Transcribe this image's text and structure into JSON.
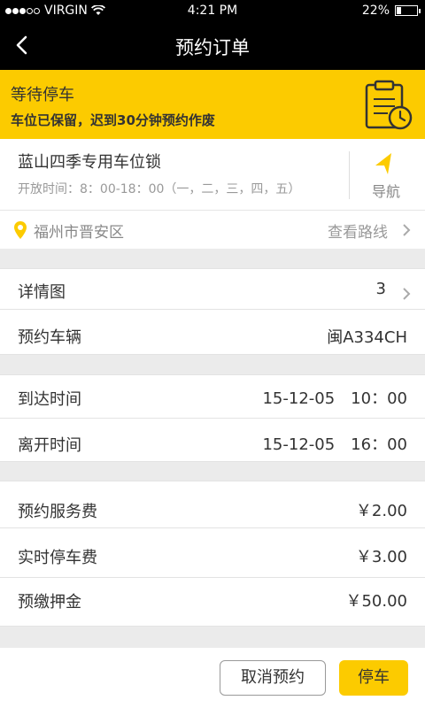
{
  "status_bar": {
    "carrier": "VIRGIN",
    "time": "4:21 PM",
    "battery": "22%",
    "signal_bars_filled": 3,
    "signal_bars_total": 5,
    "battery_level": 0.22
  },
  "nav": {
    "title": "预约订单"
  },
  "banner": {
    "status": "等待停车",
    "note": "车位已保留，迟到30分钟预约作废",
    "color": "#fccb00"
  },
  "lock": {
    "name": "蓝山四季专用车位锁",
    "hours": "开放时间：8：00-18：00（一，二，三，四，五）",
    "navigate_label": "导航"
  },
  "address": {
    "district": "福州市晋安区",
    "route_label": "查看路线"
  },
  "details": {
    "images_label": "详情图",
    "images_count": "3",
    "vehicle_label": "预约车辆",
    "vehicle_value": "闽A334CH"
  },
  "times": {
    "arrive_label": "到达时间",
    "arrive_value": "15-12-05　10：00",
    "leave_label": "离开时间",
    "leave_value": "15-12-05　16：00"
  },
  "fees": {
    "service_label": "预约服务费",
    "service_value": "￥2.00",
    "parking_label": "实时停车费",
    "parking_value": "￥3.00",
    "deposit_label": "预缴押金",
    "deposit_value": "￥50.00"
  },
  "actions": {
    "cancel_label": "取消预约",
    "park_label": "停车"
  },
  "icons": {
    "back": "chevron-left-icon",
    "clipboard": "clipboard-clock-icon",
    "navigate": "navigation-arrow-icon",
    "pin": "location-pin-icon",
    "chevron": "chevron-right-icon"
  }
}
